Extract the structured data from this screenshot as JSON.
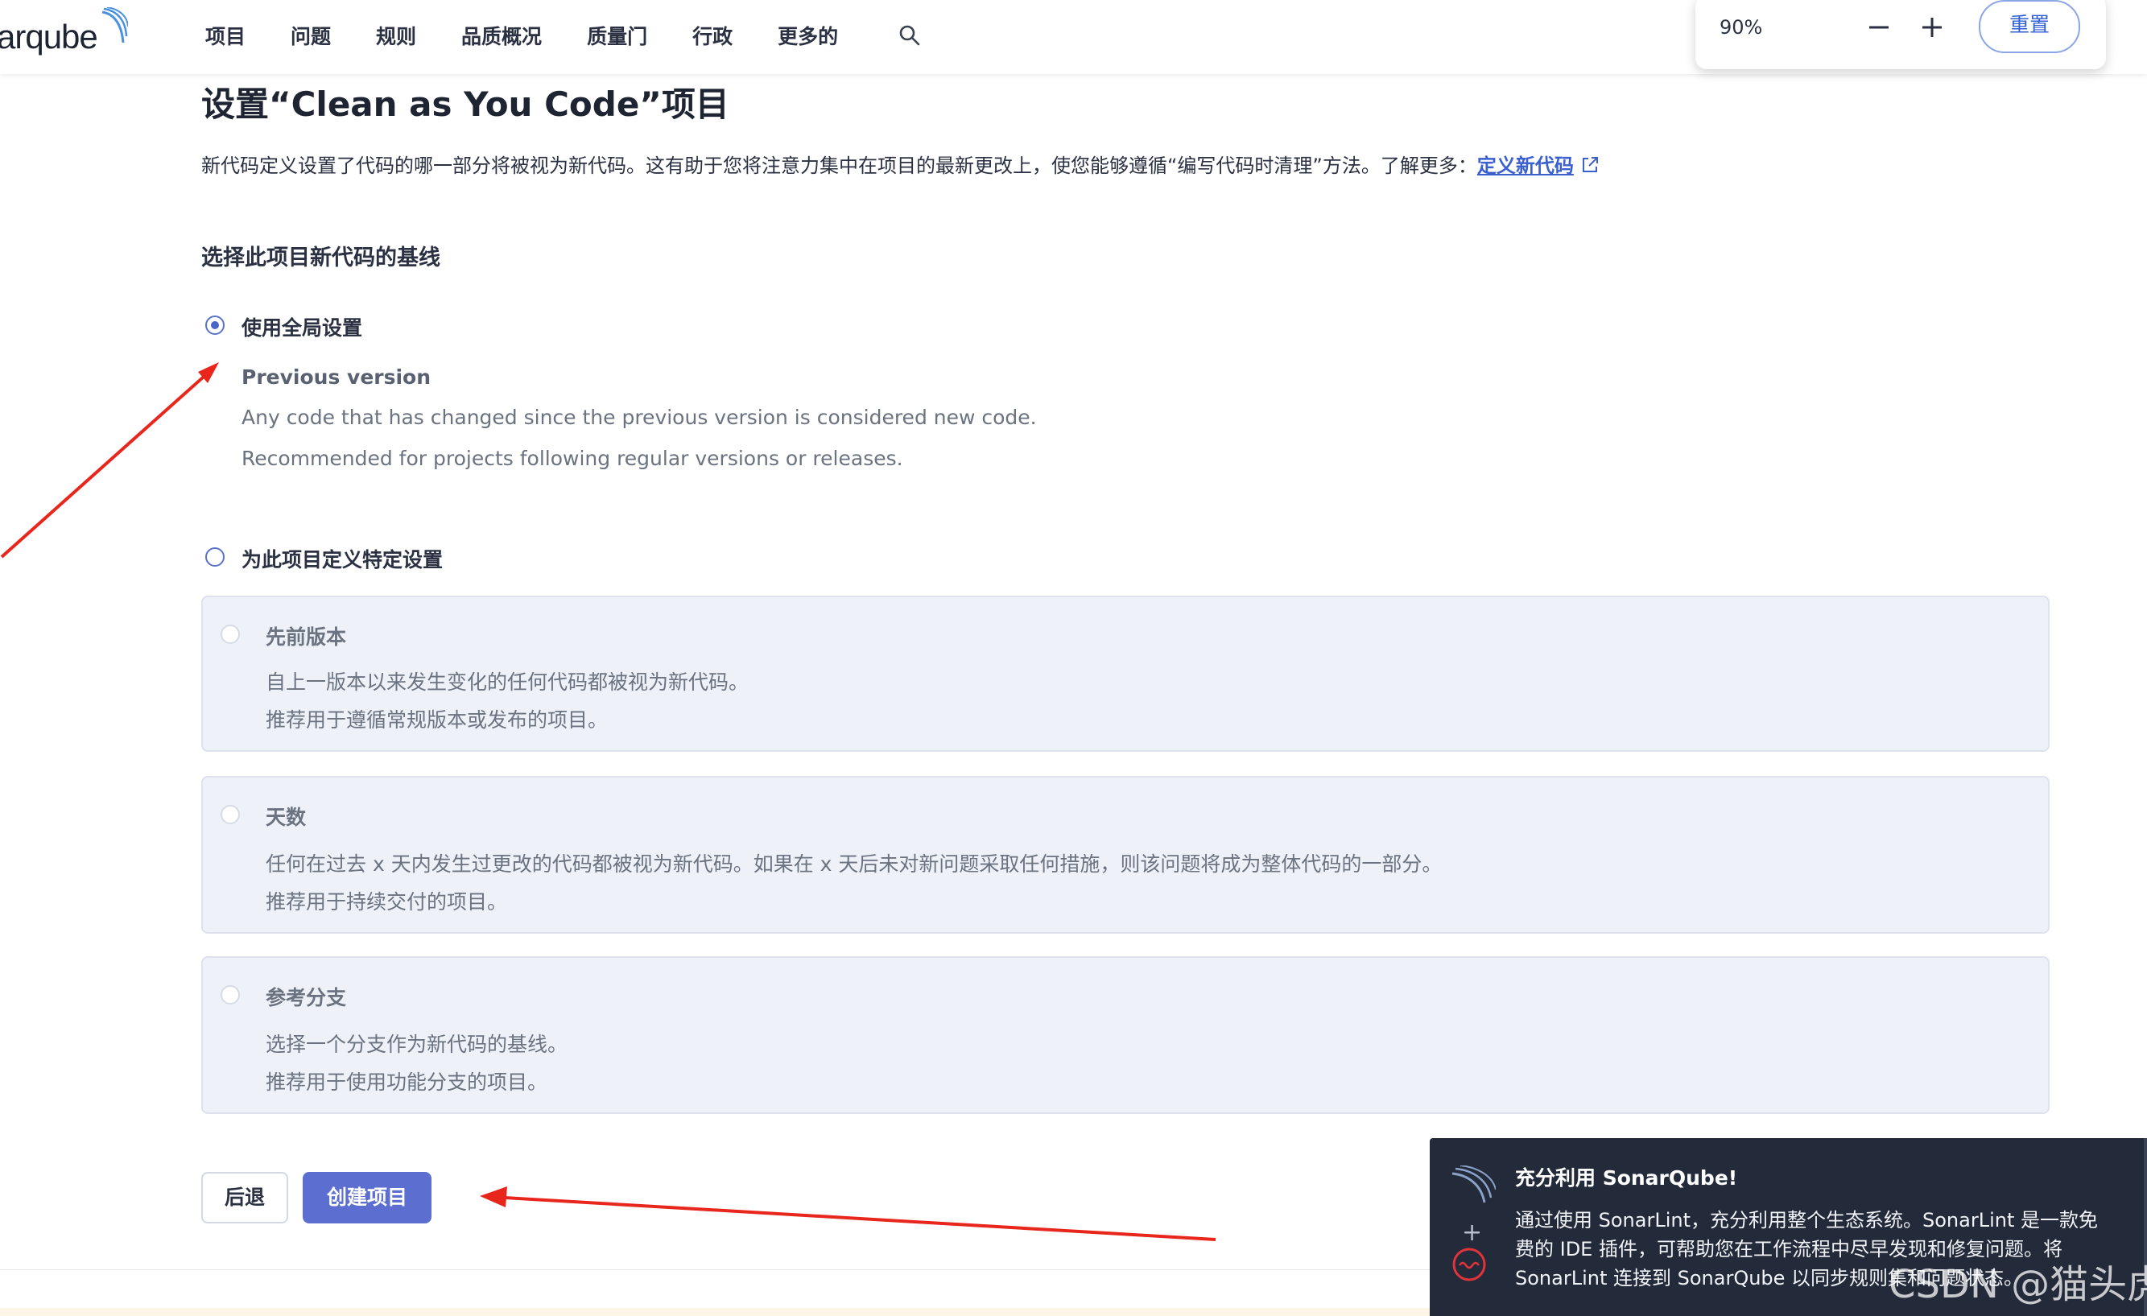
{
  "brand": {
    "logo_text": "arqube"
  },
  "nav": {
    "items": [
      "项目",
      "问题",
      "规则",
      "品质概况",
      "质量门",
      "行政",
      "更多的"
    ]
  },
  "zoom": {
    "value": "90%",
    "reset_label": "重置"
  },
  "page": {
    "title": "设置“Clean as You Code”项目",
    "description": "新代码定义设置了代码的哪一部分将被视为新代码。这有助于您将注意力集中在项目的最新更改上，使您能够遵循“编写代码时清理”方法。了解更多：",
    "learn_more_link": "定义新代码"
  },
  "baseline": {
    "section_title": "选择此项目新代码的基线",
    "global_option": {
      "label": "使用全局设置",
      "checked": true,
      "setting_title": "Previous version",
      "lines": [
        "Any code that has changed since the previous version is considered new code.",
        "Recommended for projects following regular versions or releases."
      ]
    },
    "specific_option": {
      "label": "为此项目定义特定设置",
      "checked": false,
      "cards": [
        {
          "title": "先前版本",
          "lines": [
            "自上一版本以来发生变化的任何代码都被视为新代码。",
            "推荐用于遵循常规版本或发布的项目。"
          ]
        },
        {
          "title": "天数",
          "lines": [
            "任何在过去 x 天内发生过更改的代码都被视为新代码。如果在 x 天后未对新问题采取任何措施，则该问题将成为整体代码的一部分。",
            "推荐用于持续交付的项目。"
          ]
        },
        {
          "title": "参考分支",
          "lines": [
            "选择一个分支作为新代码的基线。",
            "推荐用于使用功能分支的项目。"
          ]
        }
      ]
    }
  },
  "actions": {
    "back_label": "后退",
    "create_label": "创建项目"
  },
  "toast": {
    "title": "充分利用 SonarQube!",
    "lines": [
      "通过使用 SonarLint，充分利用整个生态系统。SonarLint 是一款免",
      "费的 IDE 插件，可帮助您在工作流程中尽早发现和修复问题。将",
      "SonarLint 连接到 SonarQube 以同步规则集和问题状态。"
    ]
  },
  "watermark": "CSDN @猫头虎",
  "colors": {
    "accent": "#5c6fd0",
    "link": "#3a5fcf",
    "annotation": "#e8261c",
    "toast_bg": "#232a3a"
  }
}
